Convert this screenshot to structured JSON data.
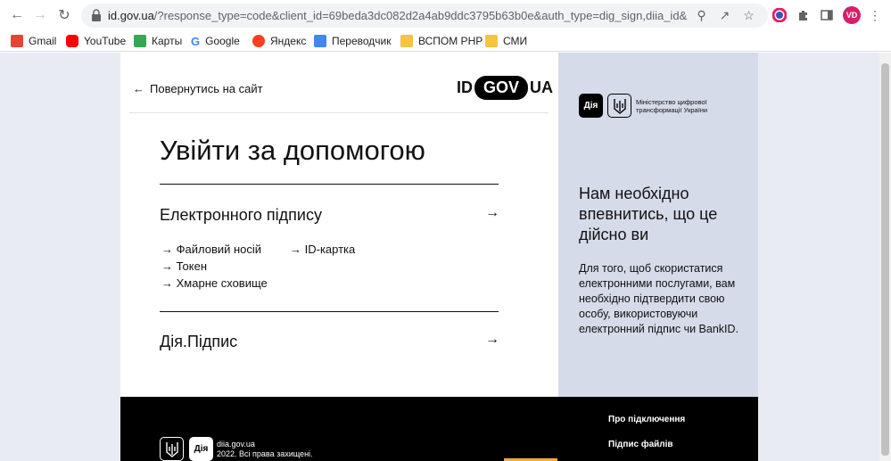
{
  "browser": {
    "url_host": "id.gov.ua",
    "url_rest": "/?response_type=code&client_id=69beda3dc082d2a4ab9ddc3795b63b0e&auth_type=dig_sign,diia_id&state=7zS...",
    "avatar_initials": "VD"
  },
  "bookmarks": [
    {
      "label": "Gmail",
      "icon": "gmail-icon",
      "color": "#ea4335"
    },
    {
      "label": "YouTube",
      "icon": "youtube-icon",
      "color": "#ff0000"
    },
    {
      "label": "Карты",
      "icon": "maps-icon",
      "color": "#34a853"
    },
    {
      "label": "Google",
      "icon": "google-icon",
      "color": "#4285f4"
    },
    {
      "label": "Яндекс",
      "icon": "yandex-icon",
      "color": "#fc3f1d"
    },
    {
      "label": "Переводчик",
      "icon": "translate-icon",
      "color": "#4285f4"
    },
    {
      "label": "ВСПОМ РНР",
      "icon": "folder-icon",
      "color": "#f6c342"
    },
    {
      "label": "СМИ",
      "icon": "folder-icon",
      "color": "#f6c342"
    }
  ],
  "header": {
    "back_label": "Повернутись на сайт",
    "logo_left": "ID",
    "logo_mid": "GOV",
    "logo_right": "UA"
  },
  "main": {
    "title": "Увійти за допомогою",
    "options": [
      {
        "label": "Електронного підпису",
        "sub": [
          "Файловий носій",
          "ID-картка",
          "Токен",
          "Хмарне сховище"
        ]
      },
      {
        "label": "Дія.Підпис",
        "sub": []
      }
    ]
  },
  "side": {
    "diia_label": "Дія",
    "ministry": "Міністерство цифрової трансформації України",
    "heading": "Нам необхідно впевнитись, що це дійсно ви",
    "body": "Для того, щоб скористатися електронними послугами, вам необхідно підтвердити свою особу, використовуючи електронний підпис чи BankID."
  },
  "footer": {
    "links": [
      "Про підключення",
      "Підпис файлів"
    ],
    "diia_label": "Дія",
    "site": "diia.gov.ua",
    "copyright": "2022. Всі права захищені."
  },
  "colors": {
    "side_bg": "#d5dbe8",
    "page_bg": "#e9ebf3",
    "footer_bg": "#000000"
  }
}
